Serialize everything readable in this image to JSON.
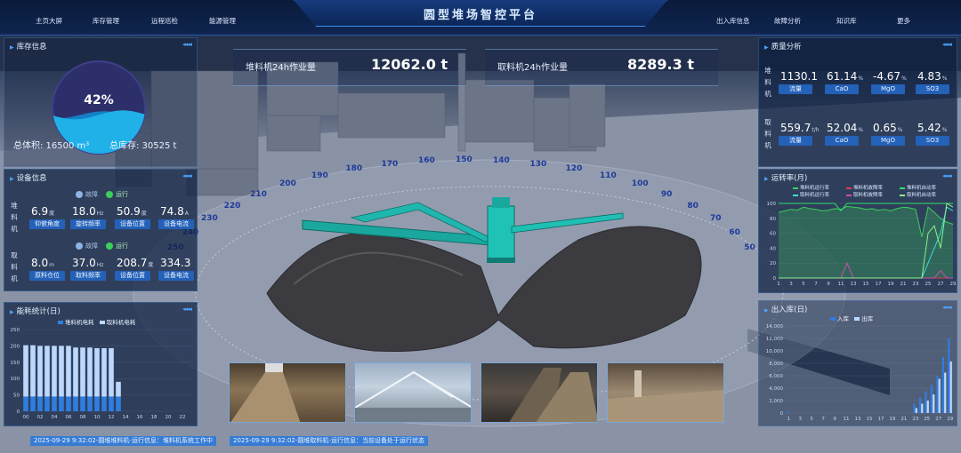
{
  "header": {
    "title": "圆型堆场智控平台",
    "nav_left": [
      "主页大屏",
      "库存管理",
      "远程巡检",
      "能源管理"
    ],
    "nav_right": [
      "出入库信息",
      "故障分析",
      "知识库",
      "更多"
    ]
  },
  "kpi": {
    "stacker_label": "堆料机24h作业量",
    "stacker_value": "12062.0 t",
    "reclaimer_label": "取料机24h作业量",
    "reclaimer_value": "8289.3 t"
  },
  "inventory": {
    "title": "库存信息",
    "percent_label": "42%",
    "fill_fraction": 0.42,
    "total_volume": "总体积: 16500 m³",
    "total_stock": "总库存: 30525 t"
  },
  "equipment": {
    "title": "设备信息",
    "status_fault": "故障",
    "status_running": "运行",
    "stacker": {
      "side_label": [
        "堆",
        "料",
        "机"
      ],
      "values": [
        {
          "value": "6.9",
          "unit": "度",
          "label": "仰俯角度"
        },
        {
          "value": "18.0",
          "unit": "Hz",
          "label": "旋转频率"
        },
        {
          "value": "50.9",
          "unit": "度",
          "label": "设备位置"
        },
        {
          "value": "74.8",
          "unit": "A",
          "label": "设备电流"
        }
      ]
    },
    "reclaimer": {
      "side_label": [
        "取",
        "料",
        "机"
      ],
      "values": [
        {
          "value": "8.0",
          "unit": "m",
          "label": "原料仓位"
        },
        {
          "value": "37.0",
          "unit": "Hz",
          "label": "取料频率"
        },
        {
          "value": "208.7",
          "unit": "度",
          "label": "设备位置"
        },
        {
          "value": "334.3",
          "unit": "",
          "label": "设备电流"
        }
      ]
    }
  },
  "energy": {
    "title": "能耗统计(日)",
    "legend": [
      "堆料机电耗",
      "取料机电耗"
    ]
  },
  "quality": {
    "title": "质量分析",
    "stacker": {
      "side_label": [
        "堆",
        "料",
        "机"
      ],
      "values": [
        {
          "value": "1130.1",
          "unit": "",
          "label": "流量"
        },
        {
          "value": "61.14",
          "unit": "%",
          "label": "CaO"
        },
        {
          "value": "-4.67",
          "unit": "%",
          "label": "MgO"
        },
        {
          "value": "4.83",
          "unit": "%",
          "label": "SO3"
        }
      ]
    },
    "reclaimer": {
      "side_label": [
        "取",
        "料",
        "机"
      ],
      "values": [
        {
          "value": "559.7",
          "unit": "t/h",
          "label": "流量"
        },
        {
          "value": "52.04",
          "unit": "%",
          "label": "CaO"
        },
        {
          "value": "0.65",
          "unit": "%",
          "label": "MgO"
        },
        {
          "value": "5.42",
          "unit": "%",
          "label": "SO3"
        }
      ]
    }
  },
  "runrate": {
    "title": "运转率(月)",
    "legend": [
      "堆料机运行率",
      "堆料机故障率",
      "堆料机自动率",
      "取料机运行率",
      "取料机故障率",
      "取料机自动率"
    ]
  },
  "inout": {
    "title": "出入库(日)",
    "legend": [
      "入库",
      "出库"
    ]
  },
  "dial_labels": [
    "250",
    "240",
    "230",
    "220",
    "210",
    "200",
    "190",
    "180",
    "170",
    "160",
    "150",
    "140",
    "130",
    "120",
    "110",
    "100",
    "90",
    "80",
    "70",
    "60",
    "50"
  ],
  "ticker": [
    "2025-09-29 9:32:02-圆堆堆料机-运行信息：堆料机系统工作中",
    "2025-09-29 9:32:02-圆堆取料机-运行信息：当前设备处于运行状态"
  ],
  "colors": {
    "accent": "#2e8cff",
    "green": "#3ad05a",
    "pink": "#d44ab0",
    "cyan": "#35e0d6",
    "bar_light": "#bcd8ff",
    "bar_blue": "#2e7de0"
  },
  "chart_data": [
    {
      "type": "bar",
      "title": "能耗统计(日)",
      "x": [
        "00",
        "01",
        "02",
        "03",
        "04",
        "05",
        "06",
        "07",
        "08",
        "09",
        "10",
        "11",
        "12",
        "13",
        "14",
        "15",
        "16",
        "17",
        "18",
        "19",
        "20",
        "21",
        "22",
        "23"
      ],
      "x_tick_labels": [
        "00",
        "02",
        "04",
        "06",
        "08",
        "10",
        "12",
        "14",
        "16",
        "18",
        "20",
        "22"
      ],
      "series": [
        {
          "name": "堆料机电耗",
          "values": [
            45,
            45,
            45,
            45,
            45,
            45,
            45,
            45,
            45,
            45,
            45,
            45,
            45,
            45,
            0,
            0,
            0,
            0,
            0,
            0,
            0,
            0,
            0,
            0
          ]
        },
        {
          "name": "取料机电耗",
          "values": [
            157,
            157,
            155,
            155,
            155,
            155,
            155,
            150,
            150,
            150,
            148,
            148,
            148,
            45,
            0,
            0,
            0,
            0,
            0,
            0,
            0,
            0,
            0,
            0
          ]
        }
      ],
      "stacked": true,
      "ylim": [
        0,
        250
      ],
      "yticks": [
        0,
        50,
        100,
        150,
        200,
        250
      ]
    },
    {
      "type": "line",
      "title": "运转率(月)",
      "x": [
        1,
        2,
        3,
        4,
        5,
        6,
        7,
        8,
        9,
        10,
        11,
        12,
        13,
        14,
        15,
        16,
        17,
        18,
        19,
        20,
        21,
        22,
        23,
        24,
        25,
        26,
        27,
        28,
        29
      ],
      "x_tick_labels": [
        "1",
        "3",
        "5",
        "7",
        "9",
        "11",
        "13",
        "15",
        "17",
        "19",
        "21",
        "23",
        "25",
        "27",
        "29"
      ],
      "ylim": [
        0,
        100
      ],
      "yticks": [
        0,
        20,
        40,
        60,
        80,
        100
      ],
      "series": [
        {
          "name": "堆料机运行率",
          "values": [
            88,
            90,
            92,
            91,
            95,
            93,
            92,
            90,
            91,
            93,
            92,
            96,
            95,
            94,
            92,
            93,
            91,
            92,
            90,
            93,
            95,
            94,
            92,
            55,
            95,
            88,
            80,
            75,
            72
          ]
        },
        {
          "name": "堆料机故障率",
          "values": [
            0,
            0,
            0,
            0,
            0,
            0,
            0,
            0,
            0,
            0,
            0,
            0,
            0,
            0,
            0,
            0,
            0,
            0,
            0,
            0,
            0,
            0,
            0,
            0,
            0,
            0,
            0,
            0,
            0
          ]
        },
        {
          "name": "堆料机自动率",
          "values": [
            100,
            100,
            100,
            100,
            100,
            100,
            100,
            100,
            100,
            100,
            90,
            100,
            100,
            100,
            100,
            100,
            100,
            100,
            100,
            100,
            100,
            100,
            100,
            100,
            100,
            100,
            100,
            100,
            100
          ]
        },
        {
          "name": "取料机运行率",
          "values": [
            0,
            0,
            0,
            0,
            0,
            0,
            0,
            0,
            0,
            0,
            0,
            0,
            0,
            0,
            0,
            0,
            0,
            0,
            0,
            0,
            0,
            0,
            0,
            0,
            20,
            40,
            60,
            95,
            90
          ]
        },
        {
          "name": "取料机故障率",
          "values": [
            0,
            0,
            0,
            0,
            0,
            0,
            0,
            0,
            0,
            0,
            0,
            20,
            0,
            0,
            0,
            0,
            0,
            0,
            0,
            0,
            0,
            0,
            0,
            0,
            0,
            0,
            10,
            0,
            0
          ]
        },
        {
          "name": "取料机自动率",
          "values": [
            0,
            0,
            0,
            0,
            0,
            0,
            0,
            0,
            0,
            0,
            0,
            0,
            0,
            0,
            0,
            0,
            0,
            0,
            0,
            0,
            0,
            0,
            0,
            0,
            60,
            70,
            40,
            100,
            95
          ]
        }
      ]
    },
    {
      "type": "bar",
      "title": "出入库(日)",
      "x": [
        1,
        2,
        3,
        4,
        5,
        6,
        7,
        8,
        9,
        10,
        11,
        12,
        13,
        14,
        15,
        16,
        17,
        18,
        19,
        20,
        21,
        22,
        23,
        24,
        25,
        26,
        27,
        28,
        29
      ],
      "x_tick_labels": [
        "1",
        "3",
        "5",
        "7",
        "9",
        "11",
        "13",
        "15",
        "17",
        "19",
        "21",
        "23",
        "25",
        "27",
        "29"
      ],
      "ylim": [
        0,
        14000
      ],
      "yticks": [
        0,
        2000,
        4000,
        6000,
        8000,
        10000,
        12000,
        14000
      ],
      "series": [
        {
          "name": "入库",
          "values": [
            200,
            0,
            0,
            0,
            0,
            0,
            0,
            0,
            0,
            0,
            0,
            0,
            0,
            0,
            0,
            0,
            0,
            0,
            0,
            0,
            0,
            0,
            1500,
            2500,
            3500,
            4500,
            6000,
            9000,
            12000
          ]
        },
        {
          "name": "出库",
          "values": [
            0,
            0,
            0,
            0,
            0,
            0,
            0,
            0,
            0,
            0,
            0,
            0,
            0,
            0,
            0,
            0,
            0,
            0,
            0,
            0,
            0,
            0,
            800,
            1500,
            2000,
            3000,
            5500,
            6500,
            8300
          ]
        }
      ]
    }
  ]
}
